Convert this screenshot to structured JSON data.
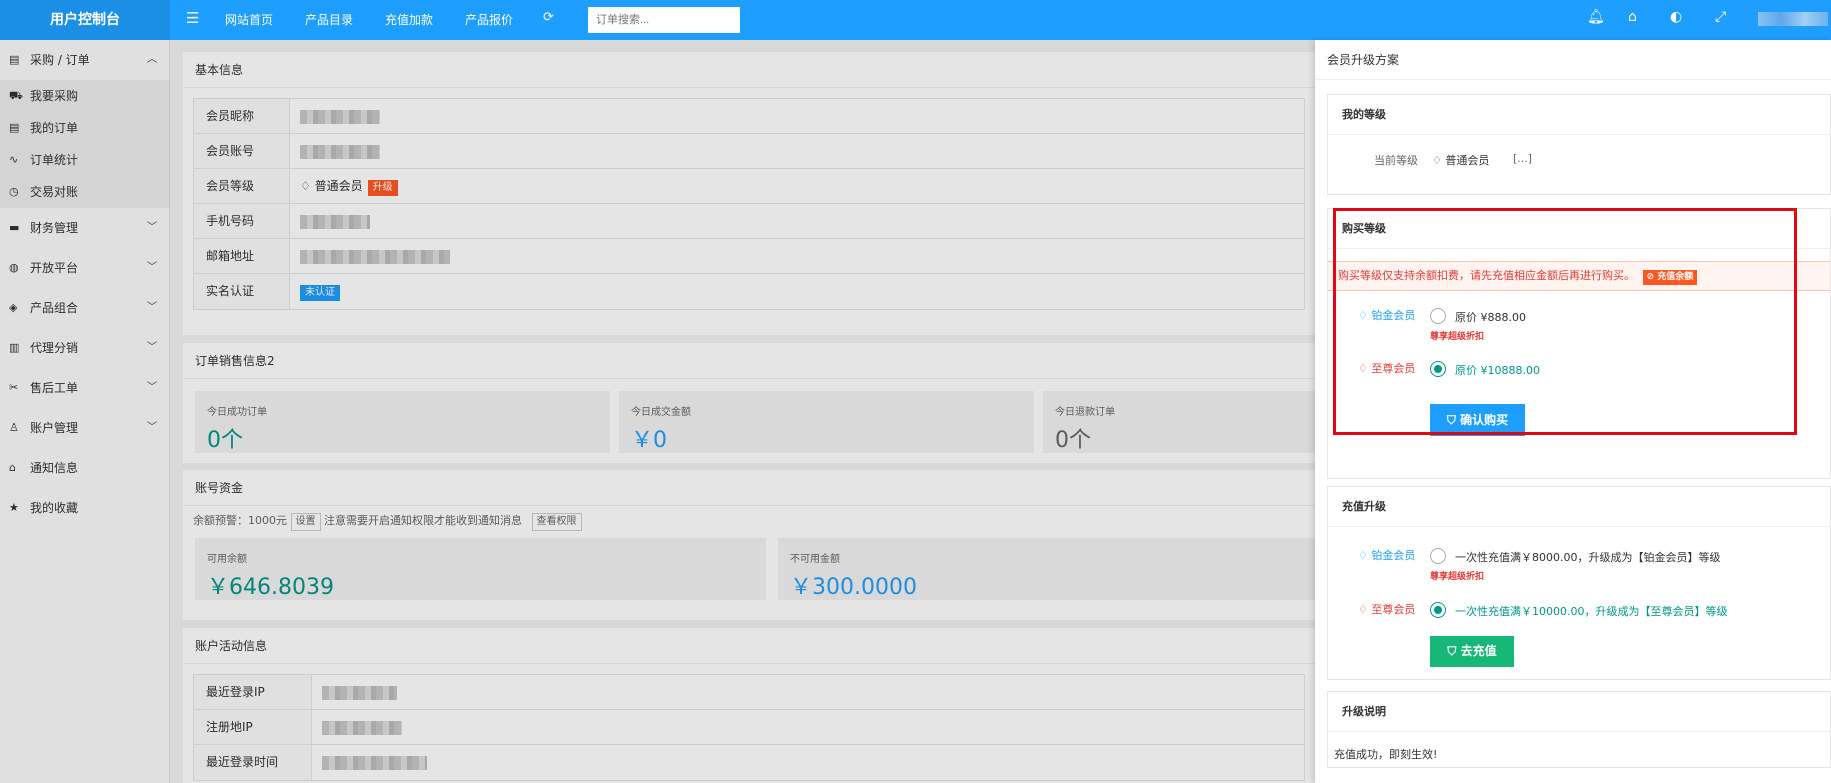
{
  "header": {
    "brand": "用户控制台",
    "nav": [
      "网站首页",
      "产品目录",
      "充值加款",
      "产品报价"
    ],
    "search_placeholder": "订单搜索...",
    "icons": [
      "menu-icon",
      "refresh-icon",
      "bell-icon",
      "tag-icon",
      "palette-icon",
      "fullscreen-icon"
    ]
  },
  "sidebar": {
    "open_group": "采购 / 订单",
    "open_items": [
      "我要采购",
      "我的订单",
      "订单统计",
      "交易对账"
    ],
    "groups": [
      "财务管理",
      "开放平台",
      "产品组合",
      "代理分销",
      "售后工单",
      "账户管理"
    ],
    "plain": [
      "通知信息",
      "我的收藏"
    ]
  },
  "basic": {
    "title": "基本信息",
    "rows": {
      "nickname": "会员昵称",
      "account": "会员账号",
      "level": "会员等级",
      "phone": "手机号码",
      "email": "邮箱地址",
      "realname": "实名认证"
    },
    "level_value": "普通会员",
    "upgrade_tag": "升级",
    "realname_tag": "未认证"
  },
  "sales": {
    "title": "订单销售信息2",
    "stats": [
      {
        "label": "今日成功订单",
        "value": "0个"
      },
      {
        "label": "今日成交金额",
        "value": "￥0"
      },
      {
        "label": "今日退款订单",
        "value": "0个"
      }
    ]
  },
  "funds": {
    "title": "账号资金",
    "warn_prefix": "余额预警：1000元",
    "set_btn": "设置",
    "warn_note": "注意需要开启通知权限才能收到通知消息",
    "perm_btn": "查看权限",
    "available_label": "可用余额",
    "available_value": "￥646.8039",
    "frozen_label": "不可用金额",
    "frozen_value": "￥300.0000"
  },
  "activity": {
    "title": "账户活动信息",
    "rows": [
      "最近登录IP",
      "注册地IP",
      "最近登录时间"
    ]
  },
  "panel": {
    "title": "会员升级方案",
    "my_level": {
      "title": "我的等级",
      "label": "当前等级",
      "value": "普通会员",
      "more": "[...]"
    },
    "buy": {
      "title": "购买等级",
      "notice": "购买等级仅支持余额扣费，请先充值相应金额后再进行购买。",
      "notice_btn": "充值余额",
      "platinum": "铂金会员",
      "platinum_price": "原价 ¥888.00",
      "platinum_hint": "尊享超级折扣",
      "supreme": "至尊会员",
      "supreme_price": "原价 ¥10888.00",
      "confirm": "确认购买"
    },
    "recharge": {
      "title": "充值升级",
      "platinum": "铂金会员",
      "platinum_text": "一次性充值满￥8000.00，升级成为【铂金会员】等级",
      "platinum_hint": "尊享超级折扣",
      "supreme": "至尊会员",
      "supreme_text": "一次性充值满￥10000.00，升级成为【至尊会员】等级",
      "go": "去充值"
    },
    "explain": {
      "title": "升级说明",
      "text": "充值成功，即刻生效!"
    }
  },
  "colors": {
    "primary": "#1e9fff",
    "teal": "#009688",
    "red": "#e53935",
    "orange": "#ff5722",
    "green": "#16b777",
    "highlight": "#e30613"
  }
}
